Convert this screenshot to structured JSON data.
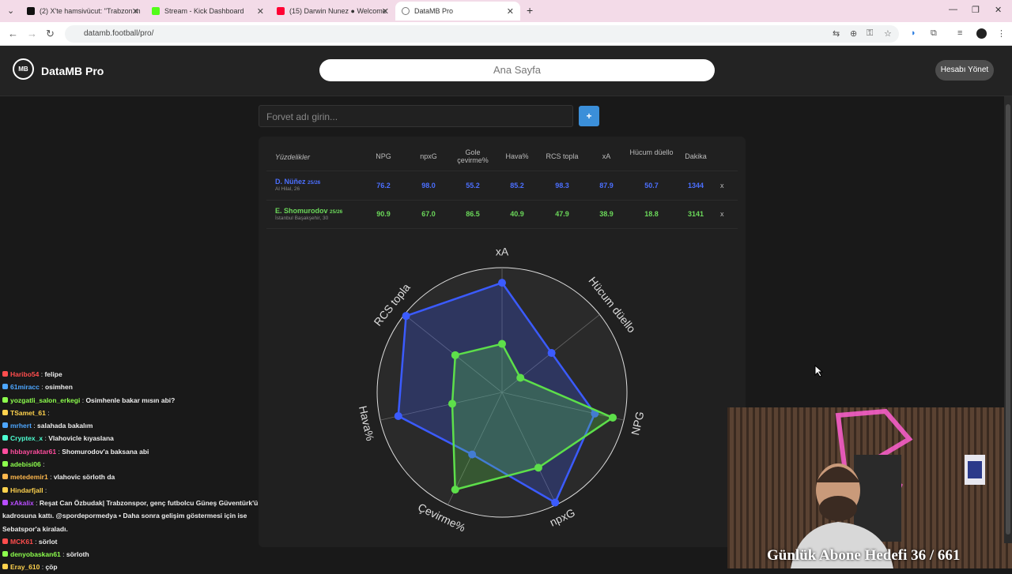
{
  "browser": {
    "tabs": [
      {
        "title": "(2) X'te hamsivücut: \"Trabzon m",
        "color": "#111"
      },
      {
        "title": "Stream - Kick Dashboard",
        "color": "#53fc18"
      },
      {
        "title": "(15) Darwin Nunez ● Welcome",
        "color": "#ff0033"
      },
      {
        "title": "DataMB Pro",
        "color": "#ffffff"
      }
    ],
    "new_tab": "+",
    "url": "datamb.football/pro/"
  },
  "app": {
    "brand": "DataMB Pro",
    "logo": "MB",
    "nav_search_label": "Ana Sayfa",
    "account_button": "Hesabı Yönet",
    "forward_placeholder": "Forvet adı girin...",
    "add_button": "+"
  },
  "table": {
    "headers": [
      "Yüzdelikler",
      "NPG",
      "npxG",
      "Gole çevirme%",
      "Hava%",
      "RCS topla",
      "xA",
      "Hücum düello",
      "Dakika"
    ],
    "rows": [
      {
        "name": "D. Nüñez",
        "season": "25/26",
        "club": "Al Hilal, 26",
        "values": [
          "76.2",
          "98.0",
          "55.2",
          "85.2",
          "98.3",
          "87.9",
          "50.7",
          "1344"
        ],
        "remove": "x"
      },
      {
        "name": "E. Shomurodov",
        "season": "25/26",
        "club": "İstanbul Başakşehir, 30",
        "values": [
          "90.9",
          "67.0",
          "86.5",
          "40.9",
          "47.9",
          "38.9",
          "18.8",
          "3141"
        ],
        "remove": "x"
      }
    ]
  },
  "chart_data": {
    "type": "radar",
    "axes": [
      "xA",
      "Hücum düello",
      "NPG",
      "npxG",
      "Çevirme%",
      "Hava%",
      "RCS topla"
    ],
    "range": [
      0,
      100
    ],
    "series": [
      {
        "name": "D. Nüñez",
        "color": "#3b5bff",
        "values": [
          87.9,
          50.7,
          76.2,
          98.0,
          55.2,
          85.2,
          98.3
        ]
      },
      {
        "name": "E. Shomurodov",
        "color": "#5ddf4a",
        "values": [
          38.9,
          18.8,
          90.9,
          67.0,
          86.5,
          40.9,
          47.9
        ]
      }
    ]
  },
  "chat": [
    {
      "user": "Haribo54",
      "color": "#ff4d4d",
      "msg": "felipe"
    },
    {
      "user": "61miracc",
      "color": "#4da6ff",
      "msg": "osimhen"
    },
    {
      "user": "yozgatli_salon_erkegi",
      "color": "#8dff4d",
      "msg": "Osimhenle bakar mısın abi?"
    },
    {
      "user": "TSamet_61",
      "color": "#ffd24d",
      "msg": ""
    },
    {
      "user": "mrhert",
      "color": "#4da6ff",
      "msg": "salahada bakalım"
    },
    {
      "user": "Cryptex_x",
      "color": "#4dffd2",
      "msg": "Vlahovicle kıyaslana"
    },
    {
      "user": "hbbayraktar61",
      "color": "#ff4d9e",
      "msg": "Shomurodov'a baksana abi"
    },
    {
      "user": "adebisi06",
      "color": "#8dff4d",
      "msg": ""
    },
    {
      "user": "metedemir1",
      "color": "#ffb84d",
      "msg": "vlahovic sörloth da"
    },
    {
      "user": "Hindarfjall",
      "color": "#ffd24d",
      "msg": ""
    },
    {
      "user": "xAkalix",
      "color": "#b84dff",
      "msg": "Reşat Can Özbudak| Trabzonspor, genç futbolcu Güneş Güventürk'ü"
    },
    {
      "user": "",
      "color": "#ffffff",
      "msg": "kadrosuna kattı. @spordepormedya • Daha sonra gelişim göstermesi için ise"
    },
    {
      "user": "",
      "color": "#ffffff",
      "msg": "Sebatspor'a kiraladı."
    },
    {
      "user": "MCK61",
      "color": "#ff4d4d",
      "msg": "sörlot"
    },
    {
      "user": "denyobaskan61",
      "color": "#8dff4d",
      "msg": "sörloth"
    },
    {
      "user": "Eray_610",
      "color": "#ffd24d",
      "msg": "çöp"
    }
  ],
  "stream_overlay": "Günlük Abone Hedefi 36 / 661"
}
